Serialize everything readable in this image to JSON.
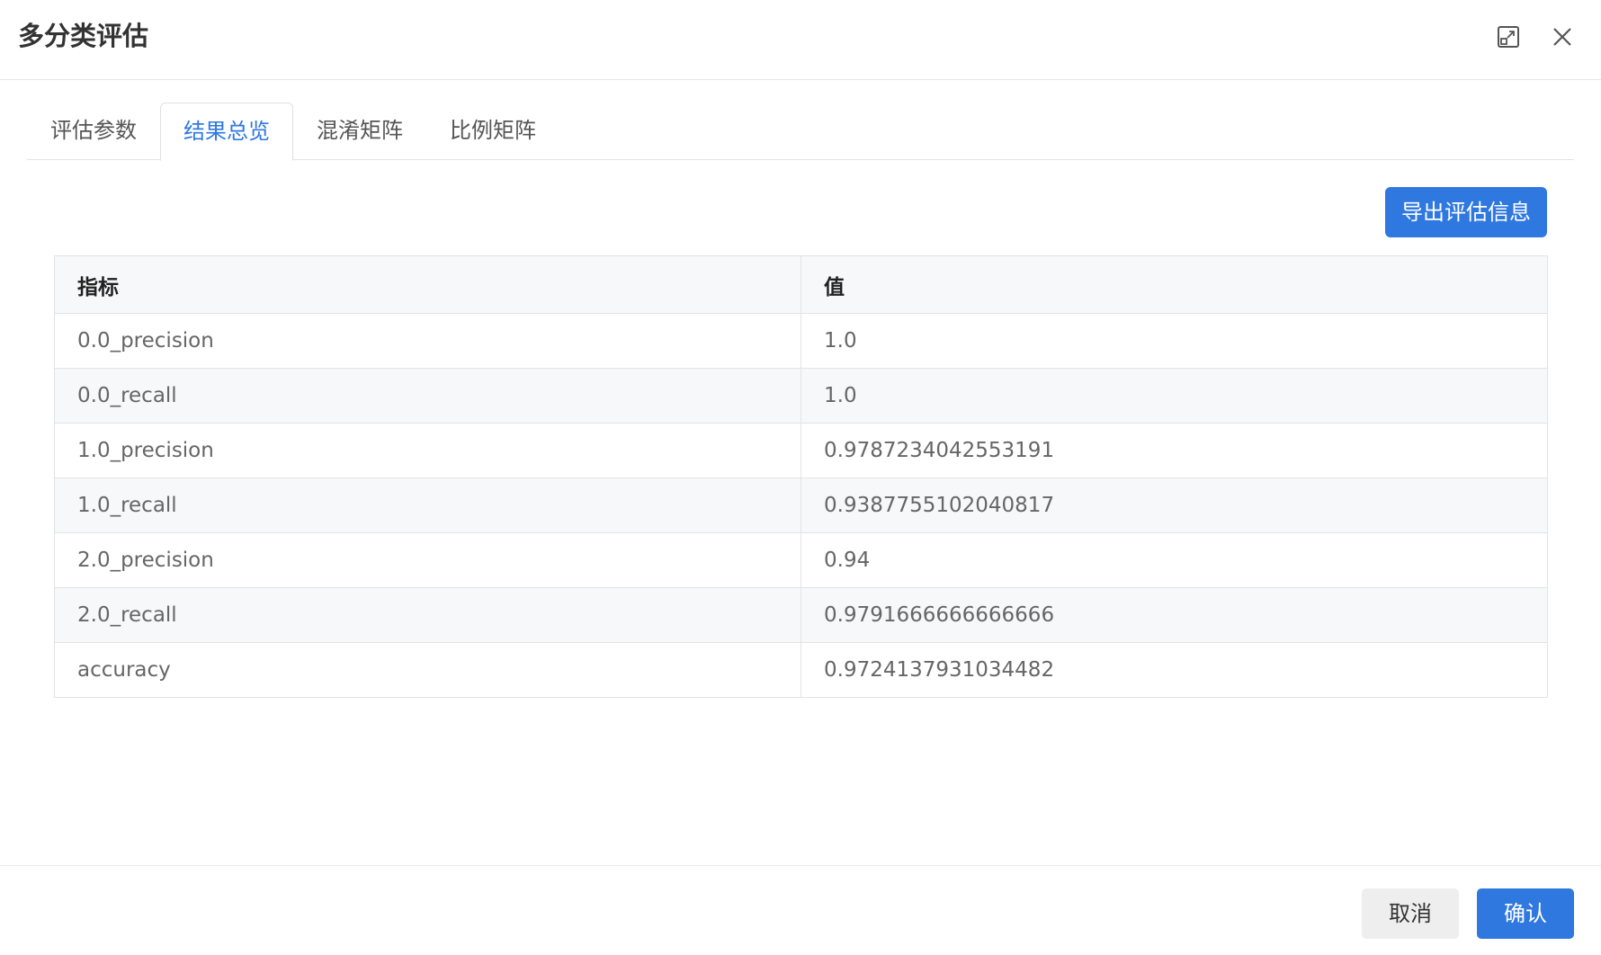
{
  "dialog": {
    "title": "多分类评估",
    "maximize_icon": "maximize-icon",
    "close_icon": "close-icon"
  },
  "tabs": [
    {
      "label": "评估参数",
      "active": false
    },
    {
      "label": "结果总览",
      "active": true
    },
    {
      "label": "混淆矩阵",
      "active": false
    },
    {
      "label": "比例矩阵",
      "active": false
    }
  ],
  "toolbar": {
    "export_label": "导出评估信息"
  },
  "table": {
    "headers": [
      "指标",
      "值"
    ],
    "rows": [
      [
        "0.0_precision",
        "1.0"
      ],
      [
        "0.0_recall",
        "1.0"
      ],
      [
        "1.0_precision",
        "0.9787234042553191"
      ],
      [
        "1.0_recall",
        "0.9387755102040817"
      ],
      [
        "2.0_precision",
        "0.94"
      ],
      [
        "2.0_recall",
        "0.9791666666666666"
      ],
      [
        "accuracy",
        "0.9724137931034482"
      ]
    ]
  },
  "footer": {
    "cancel_label": "取消",
    "confirm_label": "确认"
  },
  "colors": {
    "accent": "#2f78e0",
    "stripe": "#f7f8fa"
  }
}
